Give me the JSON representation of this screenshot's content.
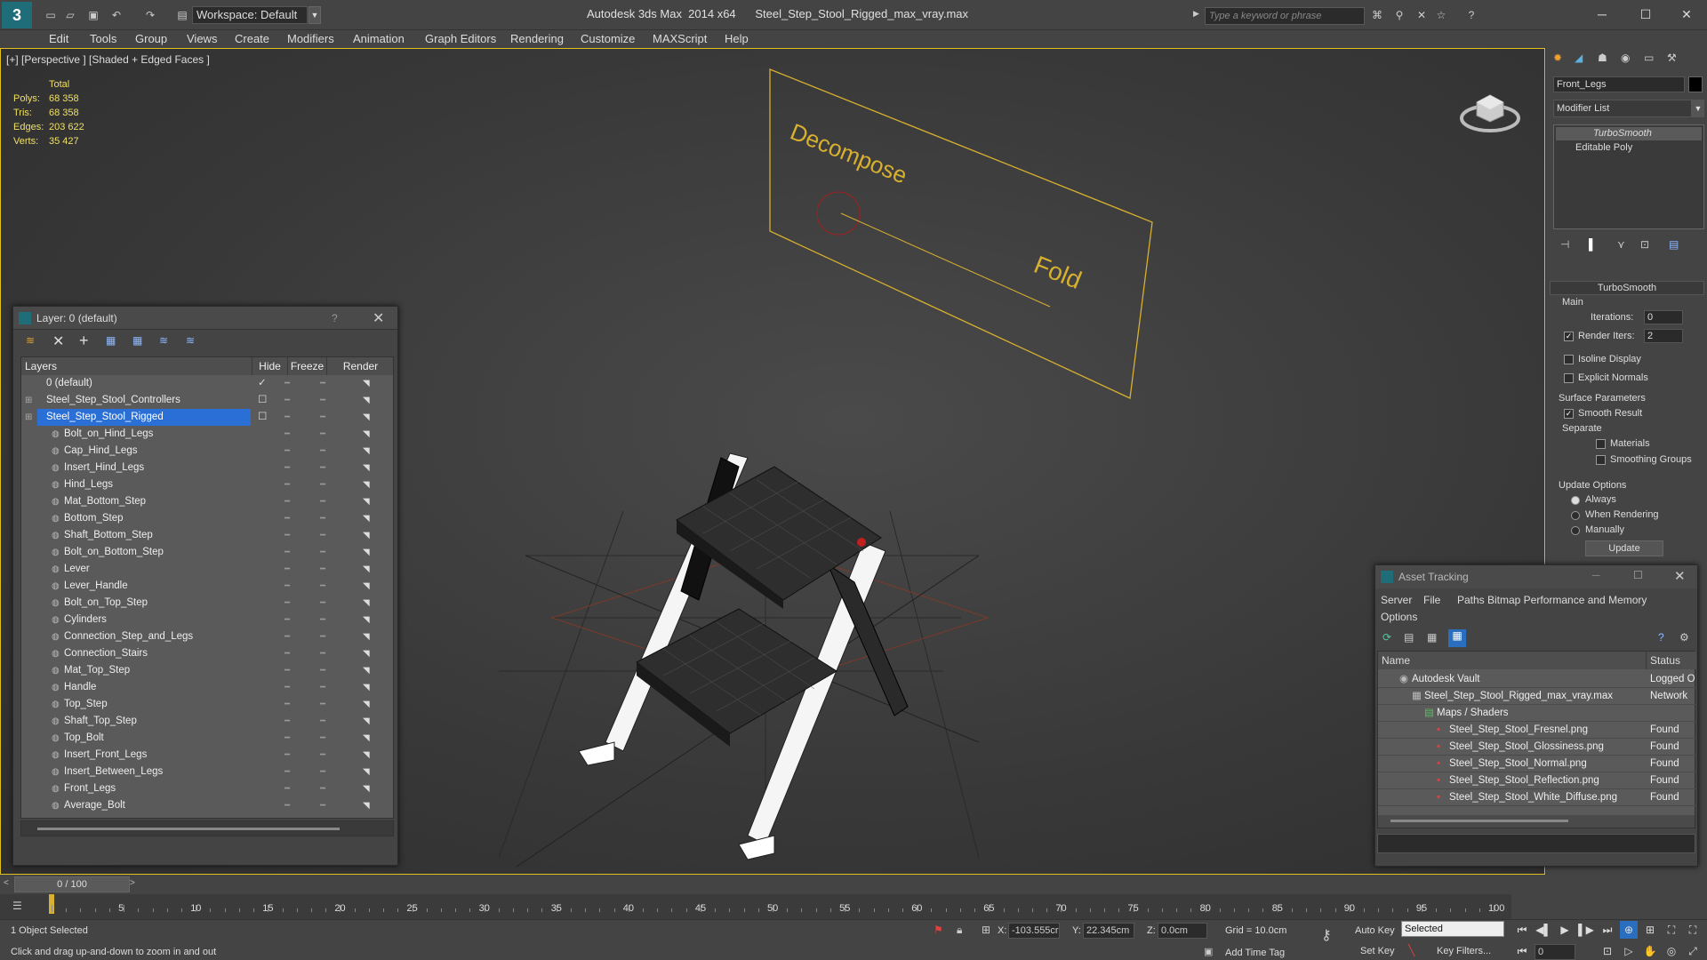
{
  "window": {
    "title": "Autodesk 3ds Max  2014 x64      Steel_Step_Stool_Rigged_max_vray.max",
    "workspace": "Workspace: Default",
    "search_placeholder": "Type a keyword or phrase"
  },
  "menu": [
    "Edit",
    "Tools",
    "Group",
    "Views",
    "Create",
    "Modifiers",
    "Animation",
    "Graph Editors",
    "Rendering",
    "Customize",
    "MAXScript",
    "Help"
  ],
  "viewport": {
    "label": "[+] [Perspective ] [Shaded + Edged Faces ]",
    "stats_header": "Total",
    "stats": [
      {
        "label": "Polys:",
        "value": "68 358"
      },
      {
        "label": "Tris:",
        "value": "68 358"
      },
      {
        "label": "Edges:",
        "value": "203 622"
      },
      {
        "label": "Verts:",
        "value": "35 427"
      }
    ],
    "panel_text_1": "Decompose",
    "panel_text_2": "Fold"
  },
  "layer_window": {
    "title": "Layer: 0 (default)",
    "help": "?",
    "columns": {
      "layers": "Layers",
      "hide": "Hide",
      "freeze": "Freeze",
      "render": "Render"
    },
    "top_layers": [
      {
        "name": "0 (default)",
        "active": true
      },
      {
        "name": "Steel_Step_Stool_Controllers",
        "active": false
      },
      {
        "name": "Steel_Step_Stool_Rigged",
        "active": false,
        "selected": true
      }
    ],
    "objects": [
      "Bolt_on_Hind_Legs",
      "Cap_Hind_Legs",
      "Insert_Hind_Legs",
      "Hind_Legs",
      "Mat_Bottom_Step",
      "Bottom_Step",
      "Shaft_Bottom_Step",
      "Bolt_on_Bottom_Step",
      "Lever",
      "Lever_Handle",
      "Bolt_on_Top_Step",
      "Cylinders",
      "Connection_Step_and_Legs",
      "Connection_Stairs",
      "Mat_Top_Step",
      "Handle",
      "Top_Step",
      "Shaft_Top_Step",
      "Top_Bolt",
      "Insert_Front_Legs",
      "Insert_Between_Legs",
      "Front_Legs",
      "Average_Bolt"
    ]
  },
  "command_panel": {
    "object_name": "Front_Legs",
    "modifier_list": "Modifier List",
    "stack": [
      "TurboSmooth",
      "Editable Poly"
    ],
    "rollout_title": "TurboSmooth",
    "main_label": "Main",
    "iterations_label": "Iterations:",
    "iterations": "0",
    "render_iters_label": "Render Iters:",
    "render_iters": "2",
    "render_iters_checked": true,
    "isoline": "Isoline Display",
    "explicit_normals": "Explicit Normals",
    "surface_params": "Surface Parameters",
    "smooth_result": "Smooth Result",
    "smooth_result_checked": true,
    "separate": "Separate",
    "materials": "Materials",
    "smoothing_groups": "Smoothing Groups",
    "update_options": "Update Options",
    "always": "Always",
    "when_rendering": "When Rendering",
    "manually": "Manually",
    "update_button": "Update"
  },
  "asset_tracking": {
    "title": "Asset Tracking",
    "menus": [
      "Server",
      "File",
      "Paths",
      "Bitmap Performance and Memory"
    ],
    "options": "Options",
    "col_name": "Name",
    "col_status": "Status",
    "rows": [
      {
        "name": "Autodesk Vault",
        "status": "Logged O",
        "indent": 0
      },
      {
        "name": "Steel_Step_Stool_Rigged_max_vray.max",
        "status": "Network",
        "indent": 1
      },
      {
        "name": "Maps / Shaders",
        "status": "",
        "indent": 2
      },
      {
        "name": "Steel_Step_Stool_Fresnel.png",
        "status": "Found",
        "indent": 3
      },
      {
        "name": "Steel_Step_Stool_Glossiness.png",
        "status": "Found",
        "indent": 3
      },
      {
        "name": "Steel_Step_Stool_Normal.png",
        "status": "Found",
        "indent": 3
      },
      {
        "name": "Steel_Step_Stool_Reflection.png",
        "status": "Found",
        "indent": 3
      },
      {
        "name": "Steel_Step_Stool_White_Diffuse.png",
        "status": "Found",
        "indent": 3
      }
    ]
  },
  "timeline": {
    "frame": "0 / 100",
    "ticks": [
      0,
      5,
      10,
      15,
      20,
      25,
      30,
      35,
      40,
      45,
      50,
      55,
      60,
      65,
      70,
      75,
      80,
      85,
      90,
      95,
      100
    ]
  },
  "status": {
    "selection": "1 Object Selected",
    "prompt": "Click and drag up-and-down to zoom in and out",
    "x_label": "X:",
    "x": "-103.555cr",
    "y_label": "Y:",
    "y": "22.345cm",
    "z_label": "Z:",
    "z": "0.0cm",
    "grid": "Grid = 10.0cm",
    "auto_key": "Auto Key",
    "selected_dropdown": "Selected",
    "set_key": "Set Key",
    "key_filters": "Key Filters...",
    "add_time_tag": "Add Time Tag",
    "current_frame": "0"
  }
}
